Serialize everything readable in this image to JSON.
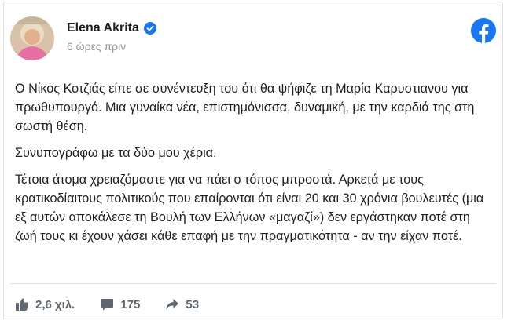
{
  "post": {
    "author": "Elena Akrita",
    "timestamp": "6 ώρες πριν",
    "paragraphs": [
      "Ο Νίκος Κοτζιάς είπε σε συνέντευξη του ότι θα ψήφιζε τη Μαρία Καρυστιανου για πρωθυπουργό. Μια γυναίκα νέα, επιστημόνισσα, δυναμική, με την καρδιά της στη σωστή θέση.",
      "Συνυπογράφω με τα δύο μου χέρια.",
      "Τέτοια άτομα χρειαζόμαστε για να πάει ο τόπος μπροστά. Αρκετά με τους κρατικοδίαιτους πολιτικούς που επαίρονται ότι είναι 20 και 30 χρόνια βουλευτές (μια εξ αυτών αποκάλεσε τη Βουλή των Ελλήνων «μαγαζί») δεν εργάστηκαν ποτέ στη ζωή τους κι έχουν χάσει κάθε επαφή με την πραγματικότητα - αν την είχαν ποτέ."
    ]
  },
  "footer": {
    "likes": "2,6 χιλ.",
    "comments": "175",
    "shares": "53"
  },
  "icons": {
    "avatar": "avatar",
    "verified": "verified-badge-icon",
    "facebook": "facebook-logo-icon",
    "like": "thumbs-up-icon",
    "comment": "comment-icon",
    "share": "share-arrow-icon"
  },
  "colors": {
    "facebook_blue": "#1877f2",
    "secondary_text": "#606770",
    "timestamp_text": "#90949c"
  }
}
